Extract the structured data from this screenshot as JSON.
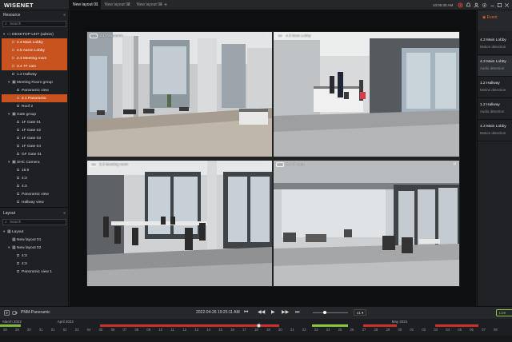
{
  "app": {
    "logo": "WISENET",
    "clock": "10:05:30 AM"
  },
  "tabs": [
    {
      "label": "New layout 01",
      "active": true
    },
    {
      "label": "New layout 02",
      "active": false
    },
    {
      "label": "New layout 03",
      "active": false
    }
  ],
  "resource_panel": {
    "title": "Resource",
    "search_placeholder": "Search",
    "items": [
      {
        "label": "DESKTOP-UHT (admin)",
        "level": 0,
        "icon": "server",
        "selected": false,
        "toggle": "▾"
      },
      {
        "label": "4.3 Main Lobby",
        "level": 1,
        "icon": "camera",
        "selected": true,
        "toggle": ""
      },
      {
        "label": "4.5 Aaron Lobby",
        "level": 1,
        "icon": "camera",
        "selected": true,
        "toggle": ""
      },
      {
        "label": "2.3 Meeting room",
        "level": 1,
        "icon": "camera",
        "selected": true,
        "toggle": ""
      },
      {
        "label": "3.4 7F cam",
        "level": 1,
        "icon": "camera",
        "selected": true,
        "toggle": ""
      },
      {
        "label": "1.2 Hallway",
        "level": 1,
        "icon": "camera",
        "selected": false,
        "toggle": ""
      },
      {
        "label": "Meeting Room group",
        "level": 1,
        "icon": "group",
        "selected": false,
        "toggle": "▾"
      },
      {
        "label": "Panoramic view",
        "level": 2,
        "icon": "camera",
        "selected": false,
        "toggle": ""
      },
      {
        "label": "2.1 Panoramic",
        "level": 2,
        "icon": "camera",
        "selected": true,
        "toggle": ""
      },
      {
        "label": "Roof 2",
        "level": 2,
        "icon": "camera",
        "selected": false,
        "toggle": ""
      },
      {
        "label": "Gate group",
        "level": 1,
        "icon": "group",
        "selected": false,
        "toggle": "▾"
      },
      {
        "label": "1F Gate 01",
        "level": 2,
        "icon": "camera",
        "selected": false,
        "toggle": ""
      },
      {
        "label": "1F Gate 02",
        "level": 2,
        "icon": "camera",
        "selected": false,
        "toggle": ""
      },
      {
        "label": "1F Gate 03",
        "level": 2,
        "icon": "camera",
        "selected": false,
        "toggle": ""
      },
      {
        "label": "1F Gate 04",
        "level": 2,
        "icon": "camera",
        "selected": false,
        "toggle": ""
      },
      {
        "label": "GF Gate 01",
        "level": 2,
        "icon": "camera",
        "selected": false,
        "toggle": ""
      },
      {
        "label": "SHC Camera",
        "level": 1,
        "icon": "group",
        "selected": false,
        "toggle": "▾"
      },
      {
        "label": "16:9",
        "level": 2,
        "icon": "camera",
        "selected": false,
        "toggle": ""
      },
      {
        "label": "4:3",
        "level": 2,
        "icon": "camera",
        "selected": false,
        "toggle": ""
      },
      {
        "label": "4:3",
        "level": 2,
        "icon": "camera",
        "selected": false,
        "toggle": ""
      },
      {
        "label": "Panoramic view",
        "level": 2,
        "icon": "camera",
        "selected": false,
        "toggle": ""
      },
      {
        "label": "Hallway view",
        "level": 2,
        "icon": "camera",
        "selected": false,
        "toggle": ""
      }
    ]
  },
  "layout_panel": {
    "title": "Layout",
    "search_placeholder": "Search",
    "items": [
      {
        "label": "Layout",
        "level": 0,
        "icon": "layout",
        "toggle": "▾"
      },
      {
        "label": "New layout 01",
        "level": 1,
        "icon": "layout",
        "toggle": ""
      },
      {
        "label": "New layout 02",
        "level": 1,
        "icon": "layout",
        "toggle": "▾"
      },
      {
        "label": "4:3",
        "level": 2,
        "icon": "camera",
        "toggle": ""
      },
      {
        "label": "4:3",
        "level": 2,
        "icon": "camera",
        "toggle": ""
      },
      {
        "label": "Panoramic view 1",
        "level": 2,
        "icon": "camera",
        "toggle": ""
      }
    ]
  },
  "cells": [
    {
      "badge": "SD",
      "label": "2.1 Panoramic"
    },
    {
      "badge": "SD",
      "label": "4.3 Main Lobby"
    },
    {
      "badge": "SD",
      "label": "2.3 Meeting room"
    },
    {
      "badge": "SD",
      "label": "3.4 7F cam"
    }
  ],
  "event_panel": {
    "button": "Event",
    "events": [
      {
        "camera": "4.3 Main Lobby",
        "type": "Motion detection",
        "highlight": false
      },
      {
        "camera": "4.3 Main Lobby",
        "type": "Audio detection",
        "highlight": true
      },
      {
        "camera": "1.2 Hallway",
        "type": "Motion detection",
        "highlight": false
      },
      {
        "camera": "1.2 Hallway",
        "type": "Audio detection",
        "highlight": false
      },
      {
        "camera": "4.3 Main Lobby",
        "type": "Motion detection",
        "highlight": false
      }
    ]
  },
  "playback": {
    "layout_name": "PNM-Panoramic",
    "datetime": "2022-04-26 19:25:11 AM",
    "speed": "x1",
    "speed_level": 0.35,
    "live_label": "Live",
    "months": [
      {
        "label": "March 2022",
        "pos": 0.005
      },
      {
        "label": "April 2022",
        "pos": 0.112
      },
      {
        "label": "May 2021",
        "pos": 0.765
      }
    ],
    "days": [
      "28",
      "29",
      "30",
      "31",
      "01",
      "02",
      "03",
      "04",
      "05",
      "06",
      "07",
      "08",
      "09",
      "10",
      "11",
      "12",
      "13",
      "14",
      "15",
      "16",
      "17",
      "18",
      "19",
      "20",
      "21",
      "22",
      "23",
      "24",
      "25",
      "26",
      "27",
      "28",
      "29",
      "30",
      "01",
      "02",
      "03",
      "04",
      "05",
      "06",
      "07",
      "08"
    ],
    "recordings": [
      {
        "from": 0.0,
        "to": 0.04,
        "color": "#7fb83a"
      },
      {
        "from": 0.195,
        "to": 0.545,
        "color": "#d0302a"
      },
      {
        "from": 0.61,
        "to": 0.68,
        "color": "#8cc63f"
      },
      {
        "from": 0.71,
        "to": 0.775,
        "color": "#d0302a"
      },
      {
        "from": 0.85,
        "to": 0.935,
        "color": "#d0302a"
      }
    ],
    "playhead": 0.505
  }
}
